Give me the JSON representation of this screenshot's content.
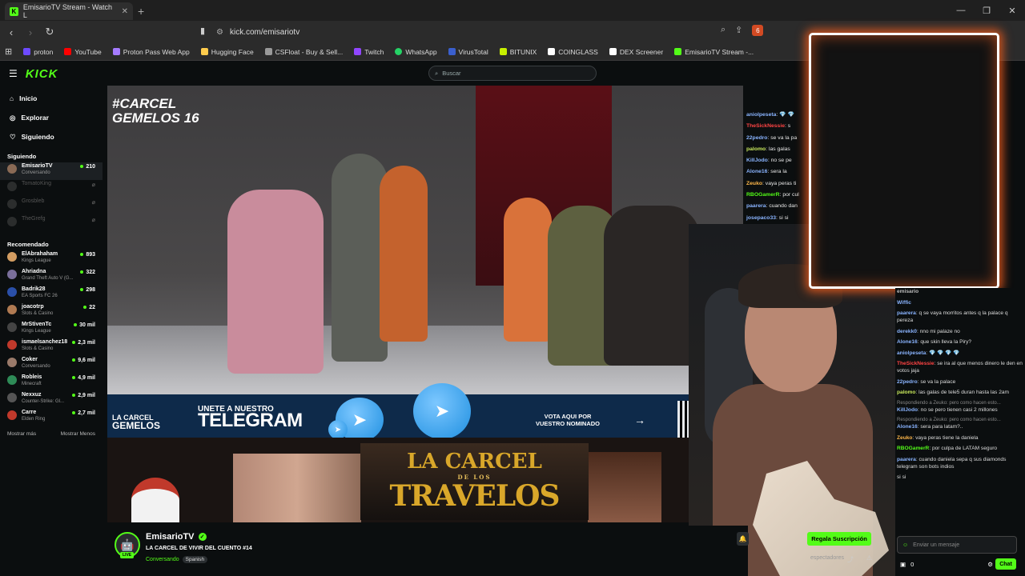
{
  "browser": {
    "tab_title": "EmisarioTV Stream - Watch L",
    "url": "kick.com/emisariotv",
    "ext_badge": "6",
    "bookmarks": [
      {
        "label": "proton",
        "color": "#6d4aff"
      },
      {
        "label": "YouTube",
        "color": "#ff0000"
      },
      {
        "label": "Proton Pass Web App",
        "color": "#a57bff"
      },
      {
        "label": "Hugging Face",
        "color": "#ffcc4d"
      },
      {
        "label": "CSFloat - Buy & Sell...",
        "color": "#999999"
      },
      {
        "label": "Twitch",
        "color": "#9146ff"
      },
      {
        "label": "WhatsApp",
        "color": "#25d366"
      },
      {
        "label": "VirusTotal",
        "color": "#3a5fcd"
      },
      {
        "label": "BITUNIX",
        "color": "#c8f000"
      },
      {
        "label": "COINGLASS",
        "color": "#ffffff"
      },
      {
        "label": "DEX Screener",
        "color": "#ffffff"
      },
      {
        "label": "EmisarioTV Stream -...",
        "color": "#53fc18"
      }
    ]
  },
  "header": {
    "logo": "KICK",
    "search_placeholder": "Buscar"
  },
  "sidebar": {
    "nav": [
      {
        "label": "Inicio",
        "icon": "home-icon"
      },
      {
        "label": "Explorar",
        "icon": "compass-icon"
      },
      {
        "label": "Siguiendo",
        "icon": "heart-icon"
      }
    ],
    "following_title": "Siguiendo",
    "following": [
      {
        "name": "EmisarioTV",
        "category": "Conversando",
        "viewers": "210",
        "live": true
      },
      {
        "name": "TomatoKing",
        "category": "",
        "viewers": "",
        "live": false
      },
      {
        "name": "Grosbleb",
        "category": "",
        "viewers": "",
        "live": false
      },
      {
        "name": "TheGrefg",
        "category": "",
        "viewers": "",
        "live": false
      }
    ],
    "recommended_title": "Recomendado",
    "recommended": [
      {
        "name": "ElAbrahaham",
        "category": "Kings League",
        "viewers": "893"
      },
      {
        "name": "Ahriadna",
        "category": "Grand Theft Auto V (G...",
        "viewers": "322"
      },
      {
        "name": "Badrik28",
        "category": "EA Sports FC 26",
        "viewers": "298"
      },
      {
        "name": "joacotrp",
        "category": "Slots & Casino",
        "viewers": "22"
      },
      {
        "name": "MrStivenTc",
        "category": "Kings League",
        "viewers": "30 mil"
      },
      {
        "name": "ismaelsanchez18",
        "category": "Slots & Casino",
        "viewers": "2,3 mil"
      },
      {
        "name": "Coker",
        "category": "Conversando",
        "viewers": "9,6 mil"
      },
      {
        "name": "Robleis",
        "category": "Minecraft",
        "viewers": "4,9 mil"
      },
      {
        "name": "Nexxuz",
        "category": "Counter-Strike: Gl...",
        "viewers": "2,9 mil"
      },
      {
        "name": "Carre",
        "category": "Elden Ring",
        "viewers": "2,7 mil"
      }
    ],
    "show_more": "Mostrar más",
    "show_less": "Mostrar Menos"
  },
  "video": {
    "hashtag_line1": "#CARCEL",
    "hashtag_line2": "GEMELOS 16",
    "banner_left_1": "LA CARCEL",
    "banner_left_2": "GEMELOS",
    "banner_join": "UNETE A NUESTRO",
    "banner_telegram": "TELEGRAM",
    "banner_vote_1": "VOTA AQUI POR",
    "banner_vote_2": "VUESTRO NOMINADO",
    "carcel_1": "LA CARCEL",
    "carcel_2": "DE LOS",
    "carcel_3": "TRAVELOS"
  },
  "chat_top": [
    {
      "user": "aniolpeseta",
      "text": ": 💎 💎",
      "color": "#8ab4ff"
    },
    {
      "user": "TheSickNessie",
      "text": ": s",
      "color": "#ff4444"
    },
    {
      "user": "22pedro",
      "text": ": se va la pa",
      "color": "#8ab4ff"
    },
    {
      "user": "palomo",
      "text": ": las galas",
      "color": "#c8e85c"
    },
    {
      "user": "KillJodo",
      "text": ": no se pe",
      "color": "#8ab4ff"
    },
    {
      "user": "Alone16",
      "text": ": sera la",
      "color": "#8ab4ff"
    },
    {
      "user": "Zeuko",
      "text": ": vaya peras ti",
      "color": "#ffb84a"
    },
    {
      "user": "RBOGamerR",
      "text": ": por cul",
      "color": "#53fc18"
    },
    {
      "user": "paarera",
      "text": ": cuando dan",
      "color": "#8ab4ff"
    },
    {
      "user": "josepaco33",
      "text": ": si si",
      "color": "#8ab4ff"
    }
  ],
  "chat": [
    {
      "reply": "",
      "user": "emisario",
      "text": "",
      "color": "#bbbbbb"
    },
    {
      "reply": "",
      "user": "Wiffic",
      "text": "",
      "color": "#8ab4ff"
    },
    {
      "reply": "",
      "user": "paarera",
      "text": ": q se vaya morritos antes q la palace q pereza",
      "color": "#8ab4ff"
    },
    {
      "reply": "",
      "user": "derekk0",
      "text": ": nno mi palaze no",
      "color": "#8ab4ff"
    },
    {
      "reply": "",
      "user": "Alone16",
      "text": ": que skin lleva la Piry?",
      "color": "#8ab4ff"
    },
    {
      "reply": "",
      "user": "aniolpeseta",
      "text": ": 💎 💎 💎 💎",
      "color": "#8ab4ff"
    },
    {
      "reply": "",
      "user": "TheSickNessie",
      "text": ": se ira al que menos dinero le den en votos jaja",
      "color": "#ff4444"
    },
    {
      "reply": "",
      "user": "22pedro",
      "text": ": se va la palace",
      "color": "#8ab4ff"
    },
    {
      "reply": "",
      "user": "palomo",
      "text": ": las galas de tele5 duran hasta las 2am",
      "color": "#c8e85c"
    },
    {
      "reply": "Respondiendo a Zeuko: pero como hacen esto...",
      "user": "KillJodo",
      "text": ": no se pero tienen casi 2 millones",
      "color": "#8ab4ff"
    },
    {
      "reply": "Respondiendo a Zeuko: pero como hacen esto...",
      "user": "Alone16",
      "text": ": sera para latam?..",
      "color": "#8ab4ff"
    },
    {
      "reply": "",
      "user": "Zeuko",
      "text": ": vaya peras tiene la daniela",
      "color": "#ffb84a"
    },
    {
      "reply": "",
      "user": "RBOGamerR",
      "text": ": por culpa de LATAM seguro",
      "color": "#53fc18"
    },
    {
      "reply": "",
      "user": "paarera",
      "text": ": cuando daniela sepa q sus diamonds telegram son bots indios",
      "color": "#8ab4ff"
    },
    {
      "reply": "",
      "user": "",
      "text": "si si",
      "color": "#8ab4ff"
    }
  ],
  "chat_input_placeholder": "Enviar un mensaje",
  "chat_count": "0",
  "chat_button": "Chat",
  "streamer": {
    "name": "EmisarioTV",
    "live_badge": "LIVE",
    "title": "LA CARCEL DE VIVIR DEL CUENTO #14",
    "category": "Conversando",
    "tag": "Spanish",
    "subscribe": "Regala Suscripción",
    "viewers_label": "espectadores"
  }
}
